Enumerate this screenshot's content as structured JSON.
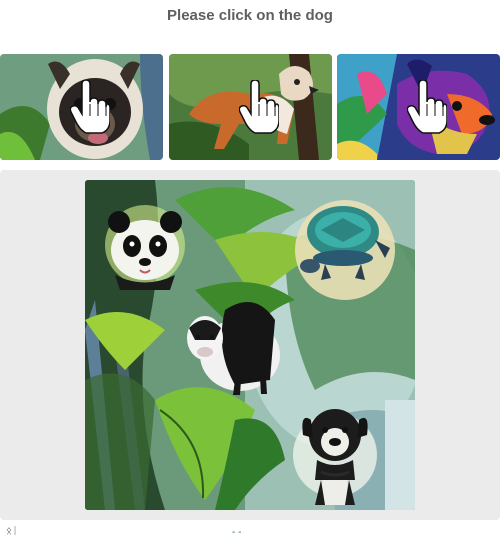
{
  "prompt": {
    "text": "Please click on the dog"
  },
  "thumbnails": [
    {
      "name": "option-1",
      "icon": "pointer-hand-icon"
    },
    {
      "name": "option-2",
      "icon": "pointer-hand-icon"
    },
    {
      "name": "option-3",
      "icon": "pointer-hand-icon"
    }
  ],
  "footer": {
    "left_fragment": "ᛟᛁ",
    "mid_fragment": "- -"
  },
  "colors": {
    "prompt_text": "#5f5f5f",
    "panel_bg": "#ebebeb",
    "page_bg": "#ffffff"
  }
}
